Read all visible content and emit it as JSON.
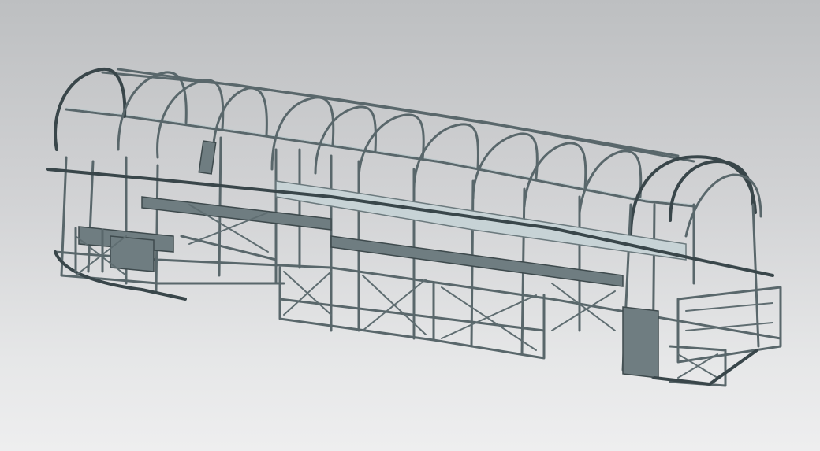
{
  "scene": {
    "subject": "bus-body-frame",
    "background_top": "#bdbfc1",
    "background_bottom": "#eeeeef",
    "frame_color": "#59676b",
    "highlight_color": "#b9c6c9",
    "panel_color": "#c7d3d6"
  }
}
